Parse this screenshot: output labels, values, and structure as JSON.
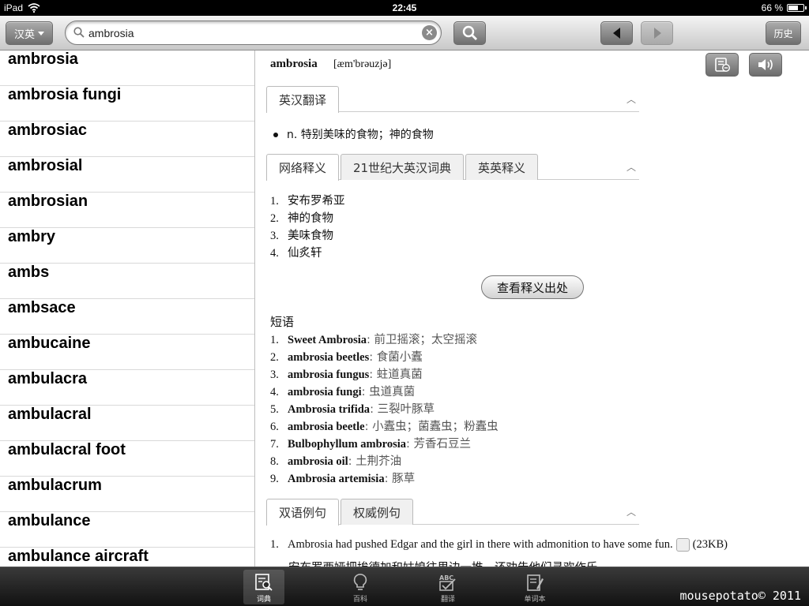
{
  "status": {
    "device": "iPad",
    "time": "22:45",
    "battery": "66 %",
    "battery_level": 0.66
  },
  "toolbar": {
    "lang_label": "汉英",
    "search_value": "ambrosia",
    "history_label": "历史"
  },
  "word_list": [
    "ambrosia",
    "ambrosia fungi",
    "ambrosiac",
    "ambrosial",
    "ambrosian",
    "ambry",
    "ambs",
    "ambsace",
    "ambucaine",
    "ambulacra",
    "ambulacral",
    "ambulacral foot",
    "ambulacrum",
    "ambulance",
    "ambulance aircraft"
  ],
  "entry": {
    "headword": "ambrosia",
    "phonetic": "[æm'brəuzjə]",
    "tab_group1": [
      "英汉翻译"
    ],
    "translation": "n. 特别美味的食物；神的食物",
    "tab_group2": [
      "网络释义",
      "21世纪大英汉词典",
      "英英释义"
    ],
    "web_meanings": [
      {
        "num": "1.",
        "text": "安布罗希亚"
      },
      {
        "num": "2.",
        "text": "神的食物"
      },
      {
        "num": "3.",
        "text": "美味食物"
      },
      {
        "num": "4.",
        "text": "仙炙轩"
      }
    ],
    "source_button": "查看释义出处",
    "phrase_heading": "短语",
    "phrases": [
      {
        "num": "1.",
        "en": "Sweet Ambrosia",
        "gloss": ": 前卫摇滚；太空摇滚"
      },
      {
        "num": "2.",
        "en": "ambrosia beetles",
        "gloss": ": 食菌小蠹"
      },
      {
        "num": "3.",
        "en": "ambrosia fungus",
        "gloss": ": 蛀道真菌"
      },
      {
        "num": "4.",
        "en": "ambrosia fungi",
        "gloss": ": 虫道真菌"
      },
      {
        "num": "5.",
        "en": "Ambrosia trifida",
        "gloss": ": 三裂叶豚草"
      },
      {
        "num": "6.",
        "en": "ambrosia beetle",
        "gloss": ": 小蠹虫；菌蠹虫；粉蠹虫"
      },
      {
        "num": "7.",
        "en": "Bulbophyllum ambrosia",
        "gloss": ": 芳香石豆兰"
      },
      {
        "num": "8.",
        "en": "ambrosia oil",
        "gloss": ": 土荆芥油"
      },
      {
        "num": "9.",
        "en": "Ambrosia artemisia",
        "gloss": ": 豚草"
      }
    ],
    "tab_group3": [
      "双语例句",
      "权威例句"
    ],
    "example": {
      "num": "1.",
      "text": "Ambrosia had pushed Edgar and the girl in there with admonition to have some fun.",
      "size": "(23KB)",
      "cn": "安布罗西娅把埃德加和姑娘往里边一推，还劝告他们寻欢作乐。"
    }
  },
  "tabbar": {
    "items": [
      "词典",
      "百科",
      "翻译",
      "单词本"
    ],
    "credit": "mousepotato© 2011"
  }
}
